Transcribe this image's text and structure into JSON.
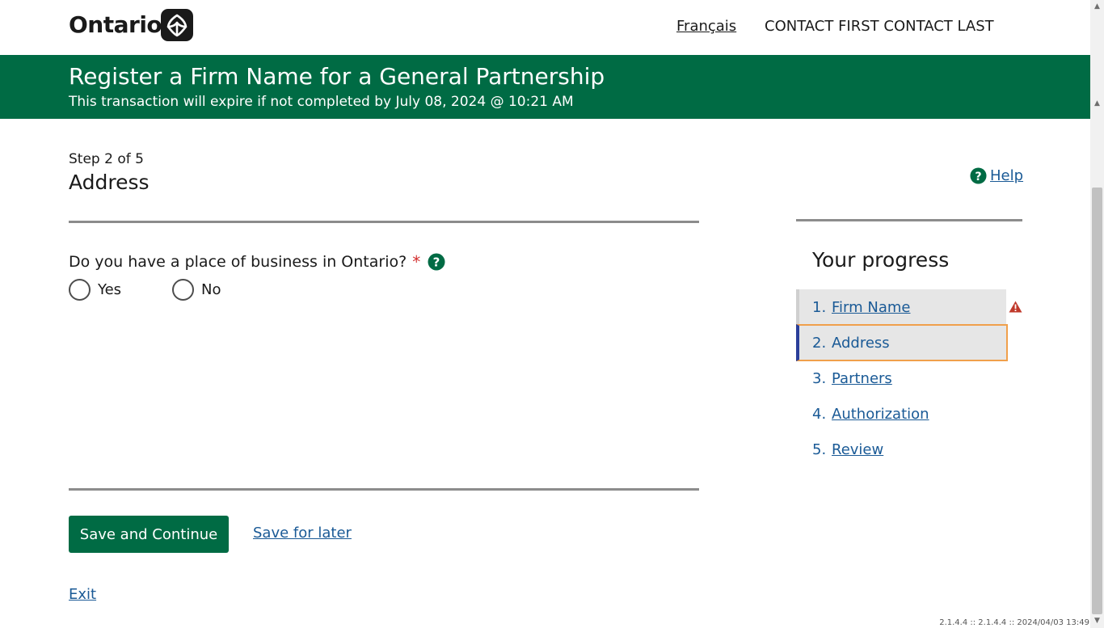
{
  "header": {
    "logo_text": "Ontario",
    "language_link": "Français",
    "user_name": "CONTACT FIRST CONTACT LAST"
  },
  "banner": {
    "title": "Register a Firm Name for a General Partnership",
    "expiry_notice": "This transaction will expire if not completed by July 08, 2024 @ 10:21 AM"
  },
  "step": {
    "label": "Step 2 of 5",
    "title": "Address",
    "help_label": "Help"
  },
  "form": {
    "question": "Do you have a place of business in Ontario?",
    "required_marker": "*",
    "options": [
      {
        "label": "Yes",
        "selected": false
      },
      {
        "label": "No",
        "selected": false
      }
    ]
  },
  "actions": {
    "save_continue": "Save and Continue",
    "save_later": "Save for later",
    "exit": "Exit"
  },
  "progress": {
    "title": "Your progress",
    "items": [
      {
        "num": "1.",
        "label": "Firm Name",
        "state": "warning"
      },
      {
        "num": "2.",
        "label": "Address",
        "state": "current"
      },
      {
        "num": "3.",
        "label": "Partners",
        "state": "todo"
      },
      {
        "num": "4.",
        "label": "Authorization",
        "state": "todo"
      },
      {
        "num": "5.",
        "label": "Review",
        "state": "todo"
      }
    ]
  },
  "footer": {
    "version": "2.1.4.4 :: 2.1.4.4 :: 2024/04/03 13:49"
  },
  "colors": {
    "brand_green": "#006b44",
    "link_blue": "#1a5a96",
    "warning_red": "#c0392b",
    "focus_orange": "#f0a04b"
  }
}
